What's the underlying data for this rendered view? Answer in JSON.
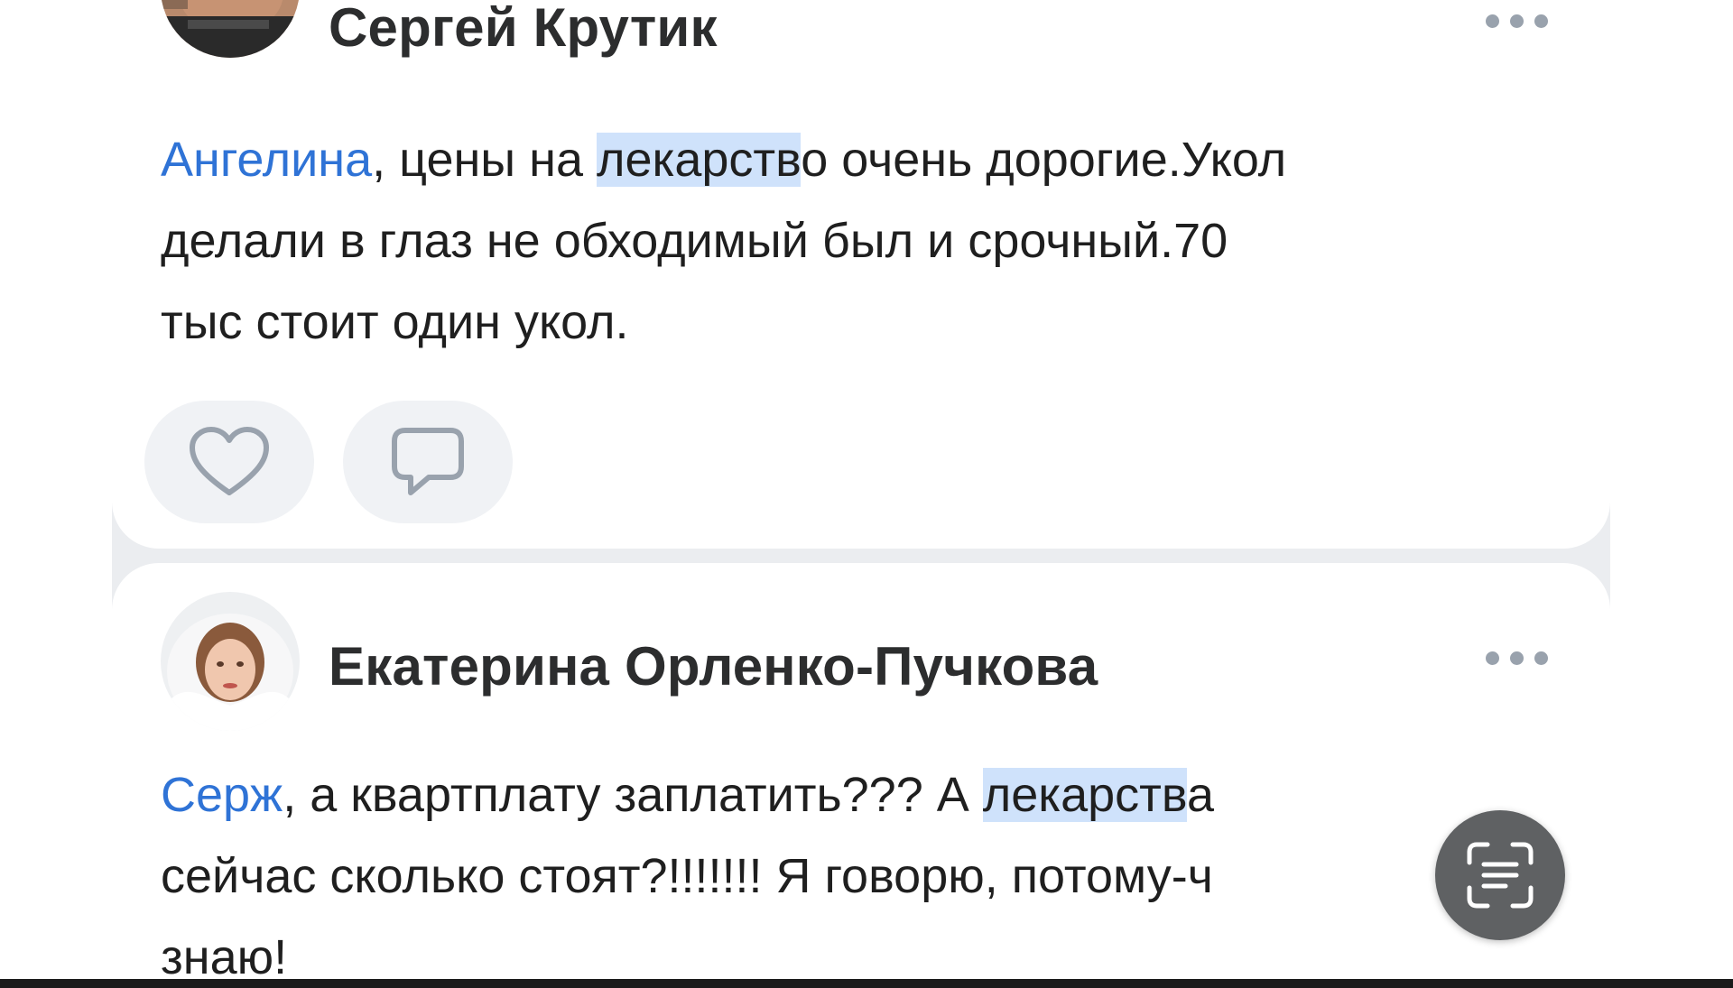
{
  "comments": [
    {
      "author": "Сергей Крутик",
      "text": {
        "mention": "Ангелина",
        "line1_a": ", цены на ",
        "line1_hl": "лекарств",
        "line1_b": "о очень дорогие.Укол",
        "line2": "делали в глаз не обходимый был и срочный.70",
        "line3": "тыс стоит один укол."
      },
      "actions": [
        {
          "icon": "heart-icon"
        },
        {
          "icon": "comment-icon"
        }
      ]
    },
    {
      "author": "Екатерина Орленко-Пучкова",
      "text": {
        "mention": "Серж",
        "line1_a": ", а квартплату заплатить??? А ",
        "line1_hl": "лекарств",
        "line1_b": "а",
        "line2": "сейчас сколько стоят?!!!!!!! Я говорю, потому-ч",
        "line3": "знаю!"
      }
    }
  ],
  "icons": {
    "more": "more-horizontal-icon",
    "scan": "text-scan-icon"
  },
  "colors": {
    "mention": "#2f73d6",
    "highlight": "#cfe2fb",
    "author": "#2c2d2e",
    "text": "#1f1f1f",
    "feed_background": "#ebedf0",
    "button_background": "#f0f2f5",
    "icon_gray": "#99a2ad",
    "scan_button": "#5f6163"
  }
}
